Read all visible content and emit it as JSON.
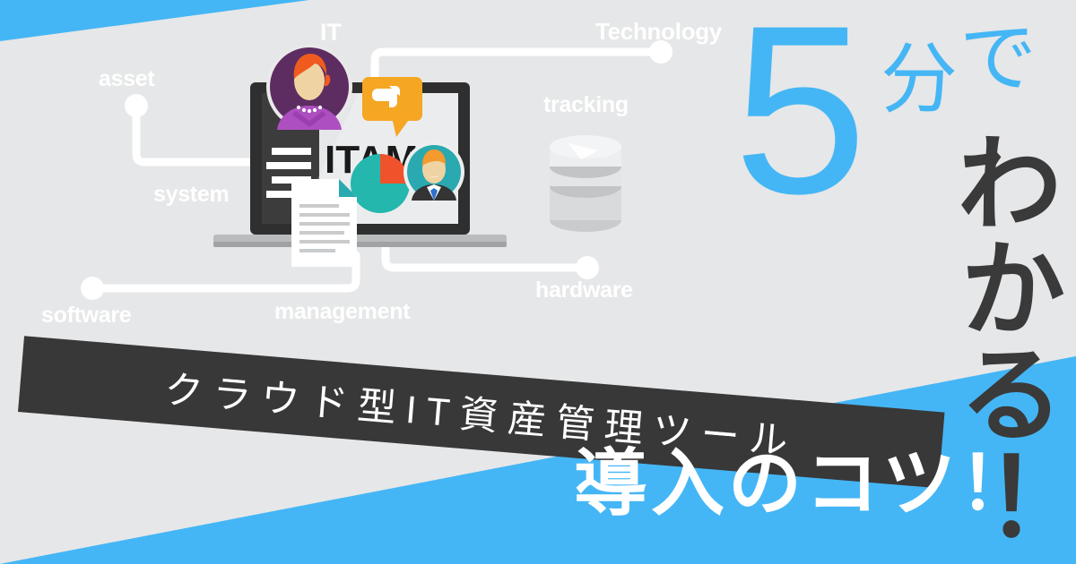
{
  "colors": {
    "background": "#e6e7e8",
    "accent_blue": "#45b6f5",
    "banner_dark": "#383838",
    "white": "#ffffff",
    "laptop_dark": "#2f2f2f",
    "avatar_purple": "#5d2d62",
    "avatar_teal": "#2aa9b0",
    "speech_orange": "#f5a623",
    "pie_orange": "#f0522b",
    "pie_teal": "#23b7ad"
  },
  "keywords": [
    {
      "name": "asset",
      "label": "asset"
    },
    {
      "name": "it",
      "label": "IT"
    },
    {
      "name": "technology",
      "label": "Technology"
    },
    {
      "name": "system",
      "label": "system"
    },
    {
      "name": "tracking",
      "label": "tracking"
    },
    {
      "name": "software",
      "label": "software"
    },
    {
      "name": "management",
      "label": "management"
    },
    {
      "name": "hardware",
      "label": "hardware"
    }
  ],
  "illustration": {
    "screen_label": "ITAM",
    "icons": [
      "laptop-icon",
      "avatar-woman-icon",
      "avatar-man-icon",
      "speech-bubble-icon",
      "pie-chart-icon",
      "document-icon",
      "database-icon"
    ]
  },
  "headline": {
    "number": "5",
    "minutes_suffix_1": "分",
    "minutes_suffix_2": "で",
    "vertical": [
      "わ",
      "か",
      "る",
      "！"
    ],
    "vertical_full": "わかる！",
    "banner_text": "クラウド型IT資産管理ツール",
    "bottom_text": "導入のコツ！"
  }
}
